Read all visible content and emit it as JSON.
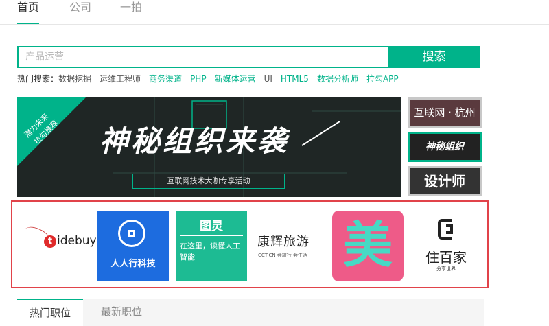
{
  "top_tabs": [
    "首页",
    "公司",
    "一拍"
  ],
  "search": {
    "placeholder": "产品运营",
    "button": "搜索"
  },
  "hot_search": {
    "label": "热门搜索：",
    "keywords": [
      "数据挖掘",
      "运维工程师",
      "商务渠道",
      "PHP",
      "新媒体运营",
      "UI",
      "HTML5",
      "数据分析师",
      "拉勾APP"
    ]
  },
  "banner": {
    "ribbon_line1": "潜力未来",
    "ribbon_line2": "拉勾推荐",
    "headline": "神秘组织来袭",
    "subline": "互联网技术大咖专享活动"
  },
  "side_banners": [
    "互联网 · 杭州",
    "神秘组织",
    "设计师"
  ],
  "logos": {
    "tidebuy": {
      "t": "t",
      "rest": "idebuy"
    },
    "renren": "人人行科技",
    "tuling": {
      "title": "图灵",
      "text": "在这里，读懂人工智能"
    },
    "kanghui": {
      "title": "康辉旅游",
      "sub": "CCT.CN 会旅行 会生活"
    },
    "mei": "美",
    "baijia": {
      "title": "住百家",
      "sub": "分享世界"
    }
  },
  "bottom_tabs": [
    "热门职位",
    "最新职位"
  ],
  "colors": {
    "accent": "#00b38a",
    "highlight_border": "#e1434a"
  }
}
